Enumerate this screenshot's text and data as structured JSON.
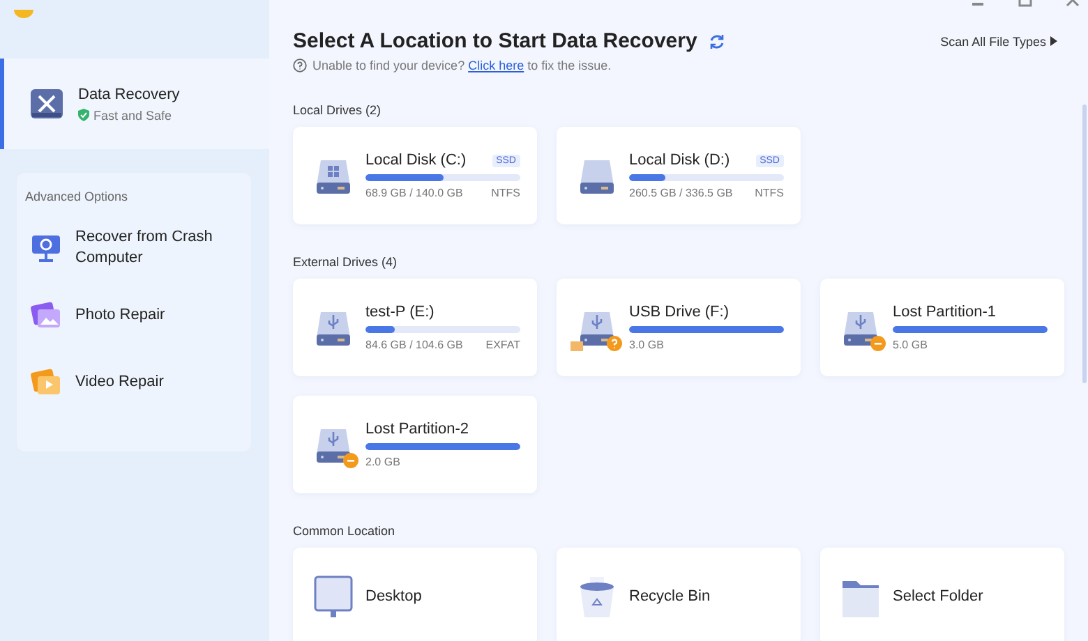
{
  "sidebar": {
    "main_item": {
      "title": "Data Recovery",
      "subtitle": "Fast and Safe",
      "selected": true
    },
    "advanced": {
      "heading": "Advanced Options",
      "items": [
        {
          "kind": "crash",
          "label": "Recover from Crash Computer",
          "selected": false
        },
        {
          "kind": "photo",
          "label": "Photo Repair",
          "selected": false
        },
        {
          "kind": "video",
          "label": "Video Repair",
          "selected": false
        }
      ]
    }
  },
  "header": {
    "title": "Select A Location to Start Data Recovery",
    "hint": "Unable to find your device?",
    "link": "Click here",
    "hint_end": "to fix the issue.",
    "scan_all": "Scan All File Types"
  },
  "sections": [
    {
      "title": "Local Drives (2)",
      "drives": [
        {
          "kind": "ssd",
          "name": "Local Disk (C:)",
          "badge": "SSD",
          "size": "68.9 GB / 140.0 GB",
          "fs": "NTFS",
          "level": 0.5,
          "unknown": false,
          "lost": false,
          "windows": true
        },
        {
          "kind": "ssd",
          "name": "Local Disk (D:)",
          "badge": "SSD",
          "size": "260.5 GB / 336.5 GB",
          "fs": "NTFS",
          "level": 0.23,
          "unknown": false,
          "lost": false,
          "windows": false
        }
      ]
    },
    {
      "title": "External Drives (4)",
      "drives": [
        {
          "kind": "usb",
          "name": "test-P (E:)",
          "size": "84.6 GB / 104.6 GB",
          "fs": "EXFAT",
          "level": 0.19,
          "unknown": false,
          "lost": false
        },
        {
          "kind": "usb",
          "name": "USB Drive (F:)",
          "size": "3.0 GB",
          "level": 1,
          "unknown": true,
          "lost": false
        },
        {
          "kind": "usb",
          "name": "Lost Partition-1",
          "size": "5.0 GB",
          "level": 1,
          "unknown": false,
          "lost": true
        },
        {
          "kind": "usb",
          "name": "Lost Partition-2",
          "size": "2.0 GB",
          "level": 1,
          "unknown": false,
          "lost": true
        }
      ]
    },
    {
      "title": "Common Location",
      "drives": [
        {
          "kind": "desktop",
          "name": "Desktop"
        },
        {
          "kind": "bin",
          "name": "Recycle Bin"
        },
        {
          "kind": "folder",
          "name": "Select Folder"
        }
      ]
    }
  ]
}
